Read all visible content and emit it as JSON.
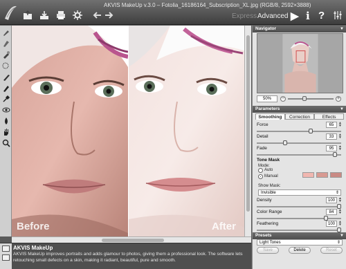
{
  "window": {
    "title": "AKVIS MakeUp v.3.0 – Fotolia_16186164_Subscription_XL.jpg (RGB/8, 2592×3888)"
  },
  "toolbar": {
    "modes": {
      "express": "Express",
      "advanced": "Advanced"
    },
    "icons": [
      "open-icon",
      "save-icon",
      "print-icon",
      "preferences-icon",
      "back-icon",
      "forward-icon",
      "run-icon",
      "info-icon",
      "help-icon",
      "settings-icon"
    ],
    "right_icons": {
      "run": "▶",
      "info": "i",
      "help": "?"
    }
  },
  "canvas": {
    "before_label": "Before",
    "after_label": "After"
  },
  "help": {
    "title": "AKVIS MakeUp",
    "text": "AKVIS MakeUp improves portraits and adds glamour to photos, giving them a professional look. The software lets retouching small defects on a skin, making it radiant, beautiful, pure and smooth."
  },
  "navigator": {
    "title": "Navigator",
    "zoom": "50%",
    "zoom_level": 0.35
  },
  "parameters": {
    "title": "Parameters",
    "tabs": [
      "Smoothing",
      "Correction",
      "Effects"
    ],
    "active_tab": "Smoothing",
    "items": [
      {
        "label": "Force",
        "value": "65",
        "level": 0.65
      },
      {
        "label": "Detail",
        "value": "33",
        "level": 0.33
      },
      {
        "label": "Fade",
        "value": "95",
        "level": 0.95
      }
    ],
    "tone_mask": {
      "title": "Tone Mask",
      "mode_label": "Mode:",
      "auto": "Auto",
      "manual": "Manual",
      "swatch_colors": [
        "#f1b7b0",
        "#d89a92",
        "#c98a84"
      ],
      "show_mask_label": "Show Mask:",
      "show_mask_value": "Invisible",
      "items": [
        {
          "label": "Density",
          "value": "100",
          "level": 1.0
        },
        {
          "label": "Color Range",
          "value": "84",
          "level": 0.84
        },
        {
          "label": "Feathering",
          "value": "100",
          "level": 1.0
        }
      ]
    }
  },
  "presets": {
    "title": "Presets",
    "selected": "Light Tones",
    "buttons": {
      "save": "Save",
      "delete": "Delete",
      "reset": "Reset"
    }
  },
  "colors": {
    "panel_header": "#5c5c5c",
    "accent_tab": "#ffffff",
    "background": "#e4e4e4"
  }
}
